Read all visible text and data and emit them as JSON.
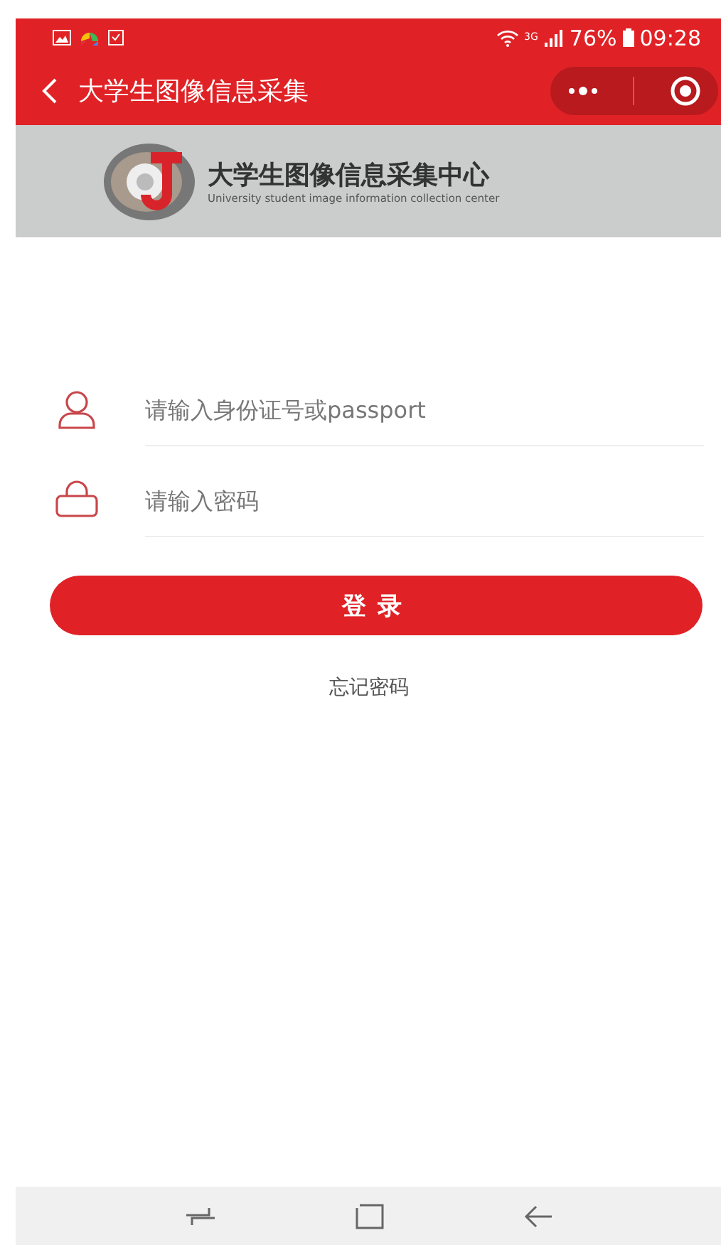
{
  "status_bar": {
    "network": "3G",
    "battery": "76%",
    "time": "09:28"
  },
  "nav_bar": {
    "title": "大学生图像信息采集"
  },
  "banner": {
    "title": "大学生图像信息采集中心",
    "subtitle": "University student image information collection center"
  },
  "form": {
    "fields": [
      {
        "kind": "user",
        "placeholder": "请输入身份证号或passport"
      },
      {
        "kind": "password",
        "placeholder": "请输入密码"
      }
    ],
    "login_button": "登录",
    "forgot_link": "忘记密码"
  }
}
